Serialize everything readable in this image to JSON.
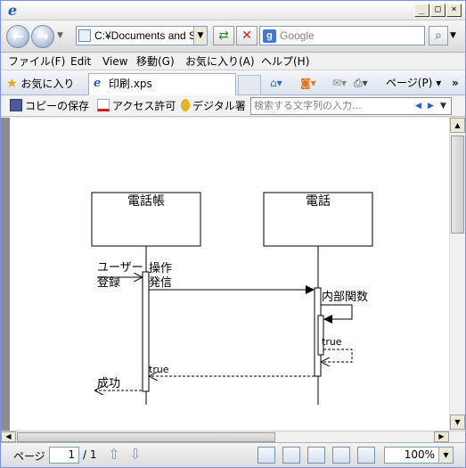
{
  "browser": {
    "address": "C:¥Documents and S",
    "search_placeholder": "Google"
  },
  "menu": [
    {
      "label": "ファイル(F)"
    },
    {
      "label": "Edit"
    },
    {
      "label": "View"
    },
    {
      "label": "移動(G)"
    },
    {
      "label": "お気に入り(A)"
    },
    {
      "label": "ヘルプ(H)"
    }
  ],
  "favorites_label": "お気に入り",
  "tab": {
    "title": "印刷.xps"
  },
  "command_bar": {
    "page_label": "ページ(P)"
  },
  "xps_toolbar": {
    "save_copy": "コピーの保存",
    "access": "アクセス許可",
    "signature": "デジタル署",
    "search_placeholder": "検索する文字列の入力..."
  },
  "diagram": {
    "lifelines": [
      "電話帳",
      "電話"
    ],
    "messages": {
      "user_label_1": "ユーザー",
      "user_label_2": "登録",
      "op_label_1": "操作",
      "op_label_2": "発信",
      "internal": "内部関数",
      "return_inner": "true",
      "return_outer": "true",
      "success": "成功"
    }
  },
  "status": {
    "page_label": "ページ",
    "page_current": "1",
    "page_total": "/ 1",
    "zoom": "100%"
  }
}
